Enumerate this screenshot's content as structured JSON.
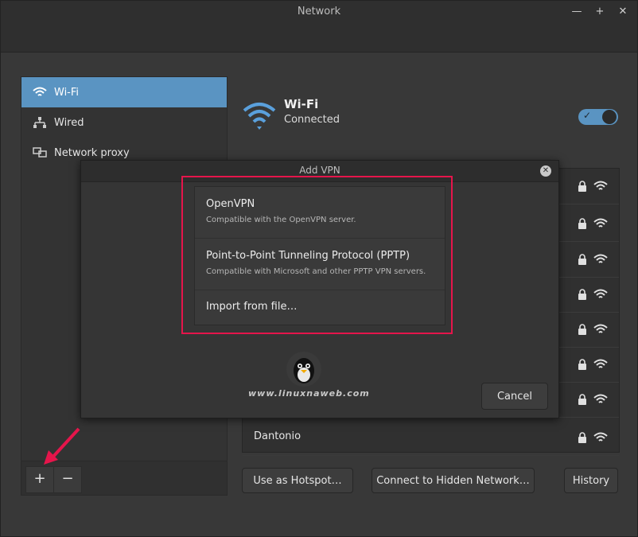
{
  "window": {
    "title": "Network"
  },
  "titlebar_buttons": [
    "minimize",
    "maximize",
    "close"
  ],
  "sidebar": {
    "items": [
      {
        "label": "Wi-Fi",
        "icon": "wifi-icon",
        "active": true
      },
      {
        "label": "Wired",
        "icon": "wired-network-icon",
        "active": false
      },
      {
        "label": "Network proxy",
        "icon": "network-proxy-icon",
        "active": false
      }
    ],
    "add_label": "+",
    "remove_label": "−"
  },
  "wifi": {
    "title": "Wi-Fi",
    "status": "Connected",
    "enabled": true
  },
  "networks": [
    {
      "name": "",
      "secured": true
    },
    {
      "name": "",
      "secured": true
    },
    {
      "name": "",
      "secured": true
    },
    {
      "name": "",
      "secured": true
    },
    {
      "name": "",
      "secured": true
    },
    {
      "name": "",
      "secured": true
    },
    {
      "name": "",
      "secured": true
    },
    {
      "name": "Dantonio",
      "secured": true
    }
  ],
  "footer_buttons": {
    "hotspot": "Use as Hotspot…",
    "hidden": "Connect to Hidden Network…",
    "history": "History"
  },
  "dialog": {
    "title": "Add VPN",
    "options": [
      {
        "title": "OpenVPN",
        "subtitle": "Compatible with the OpenVPN server."
      },
      {
        "title": "Point-to-Point Tunneling Protocol (PPTP)",
        "subtitle": "Compatible with Microsoft and other PPTP VPN servers."
      },
      {
        "title": "Import from file…",
        "subtitle": ""
      }
    ],
    "cancel_label": "Cancel"
  },
  "watermark": "www.linuxnaweb.com",
  "colors": {
    "accent": "#5a94c2",
    "highlight": "#e5154b"
  }
}
